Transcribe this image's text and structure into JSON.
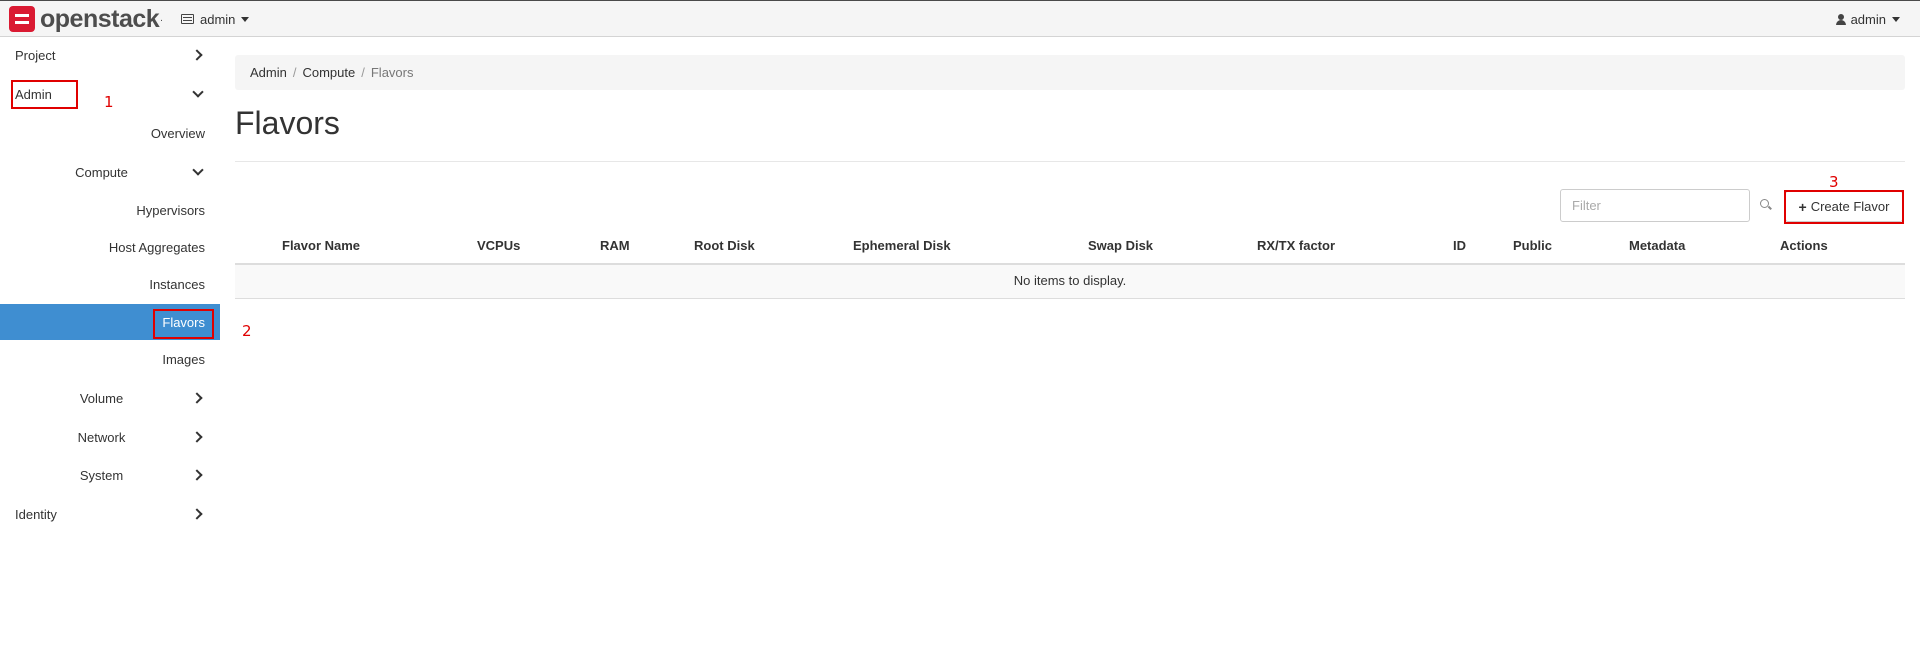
{
  "navbar": {
    "brand_name": "openstack",
    "brand_suffix": ".",
    "project_selector": "admin",
    "user_menu": "admin"
  },
  "sidebar": {
    "project": "Project",
    "admin": "Admin",
    "overview": "Overview",
    "compute": "Compute",
    "hypervisors": "Hypervisors",
    "host_aggregates": "Host Aggregates",
    "instances": "Instances",
    "flavors": "Flavors",
    "images": "Images",
    "volume": "Volume",
    "network": "Network",
    "system": "System",
    "identity": "Identity"
  },
  "annotations": {
    "one": "1",
    "two": "2",
    "three": "3"
  },
  "breadcrumb": {
    "admin": "Admin",
    "compute": "Compute",
    "current": "Flavors",
    "separator": "/"
  },
  "page": {
    "title": "Flavors"
  },
  "toolbar": {
    "filter_placeholder": "Filter",
    "create_label": "Create Flavor",
    "create_icon": "+"
  },
  "table": {
    "columns": [
      "Flavor Name",
      "VCPUs",
      "RAM",
      "Root Disk",
      "Ephemeral Disk",
      "Swap Disk",
      "RX/TX factor",
      "ID",
      "Public",
      "Metadata",
      "Actions"
    ],
    "empty_message": "No items to display."
  },
  "colors": {
    "active_nav": "#3f8ed1",
    "brand_red": "#da1a32",
    "annotation_red": "#e00000"
  }
}
